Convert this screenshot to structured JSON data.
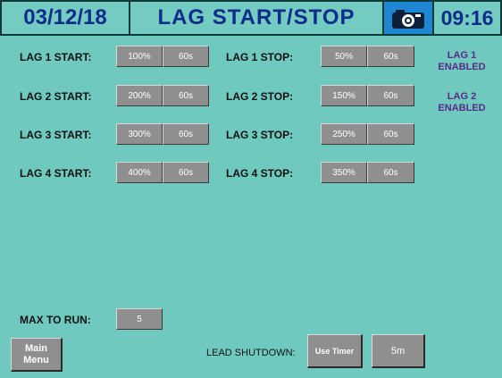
{
  "header": {
    "date": "03/12/18",
    "title": "LAG START/STOP",
    "camera_icon": "camera-icon",
    "time": "09:16"
  },
  "lags": [
    {
      "start_label": "LAG 1 START:",
      "start_pct": "100%",
      "start_time": "60s",
      "stop_label": "LAG 1 STOP:",
      "stop_pct": "50%",
      "stop_time": "60s",
      "status_line1": "LAG 1",
      "status_line2": "ENABLED"
    },
    {
      "start_label": "LAG 2 START:",
      "start_pct": "200%",
      "start_time": "60s",
      "stop_label": "LAG 2 STOP:",
      "stop_pct": "150%",
      "stop_time": "60s",
      "status_line1": "LAG 2",
      "status_line2": "ENABLED"
    },
    {
      "start_label": "LAG 3 START:",
      "start_pct": "300%",
      "start_time": "60s",
      "stop_label": "LAG 3 STOP:",
      "stop_pct": "250%",
      "stop_time": "60s"
    },
    {
      "start_label": "LAG 4 START:",
      "start_pct": "400%",
      "start_time": "60s",
      "stop_label": "LAG 4 STOP:",
      "stop_pct": "350%",
      "stop_time": "60s"
    }
  ],
  "max_to_run": {
    "label": "MAX TO RUN:",
    "value": "5"
  },
  "footer": {
    "menu_line1": "Main",
    "menu_line2": "Menu",
    "lead_label": "LEAD SHUTDOWN:",
    "lead_mode": "Use Timer",
    "lead_time": "5m"
  },
  "colors": {
    "background": "#6fc9bf",
    "header_bar": "#0f3a37",
    "header_text": "#0d2d8a",
    "button": "#8f8f8f",
    "status_text": "#5a2a88",
    "camera_button": "#1f86d1"
  }
}
